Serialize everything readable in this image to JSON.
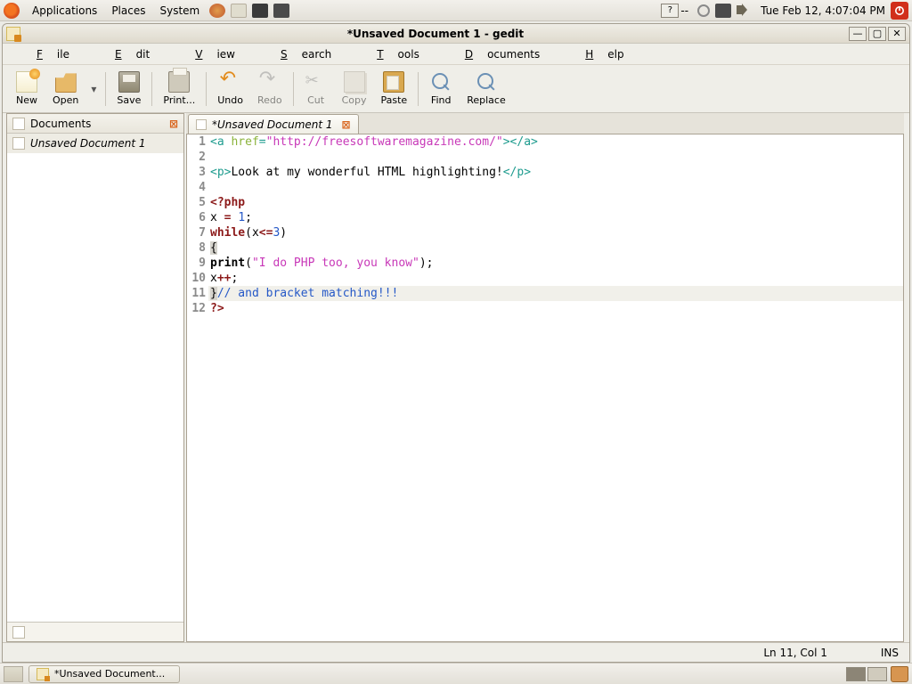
{
  "gnome": {
    "menus": [
      "Applications",
      "Places",
      "System"
    ],
    "help_badge": "?",
    "help_dash": "--",
    "clock": "Tue Feb 12,  4:07:04 PM"
  },
  "window": {
    "title": "*Unsaved Document 1 - gedit"
  },
  "menubar": {
    "items": [
      {
        "pre": "",
        "u": "F",
        "post": "ile"
      },
      {
        "pre": "",
        "u": "E",
        "post": "dit"
      },
      {
        "pre": "",
        "u": "V",
        "post": "iew"
      },
      {
        "pre": "",
        "u": "S",
        "post": "earch"
      },
      {
        "pre": "",
        "u": "T",
        "post": "ools"
      },
      {
        "pre": "",
        "u": "D",
        "post": "ocuments"
      },
      {
        "pre": "",
        "u": "H",
        "post": "elp"
      }
    ]
  },
  "toolbar": {
    "new": "New",
    "open": "Open",
    "save": "Save",
    "print": "Print...",
    "undo": "Undo",
    "redo": "Redo",
    "cut": "Cut",
    "copy": "Copy",
    "paste": "Paste",
    "find": "Find",
    "replace": "Replace"
  },
  "sidepanel": {
    "title": "Documents",
    "doc": "Unsaved Document 1"
  },
  "tab": {
    "label": "*Unsaved Document 1"
  },
  "code": {
    "l1": {
      "a": "<a ",
      "b": "href",
      "c": "=",
      "d": "\"http://freesoftwaremagazine.com/\"",
      "e": "></a>"
    },
    "l3": {
      "a": "<p>",
      "b": "Look at my wonderful HTML highlighting!",
      "c": "</p>"
    },
    "l5": "<?php",
    "l6": {
      "a": "x ",
      "b": "= ",
      "c": "1",
      "d": ";"
    },
    "l7": {
      "a": "while",
      "b": "(x",
      "c": "<=",
      "d": "3",
      "e": ")"
    },
    "l8": "{",
    "l9": {
      "a": "print",
      "b": "(",
      "c": "\"I do PHP too, you know\"",
      "d": ");"
    },
    "l10": {
      "a": "x",
      "b": "++",
      "c": ";"
    },
    "l11": {
      "a": "}",
      "b": "// and bracket matching!!!"
    },
    "l12": "?>"
  },
  "statusbar": {
    "pos": "Ln 11, Col 1",
    "mode": "INS"
  },
  "taskbar": {
    "task": "*Unsaved Document..."
  }
}
